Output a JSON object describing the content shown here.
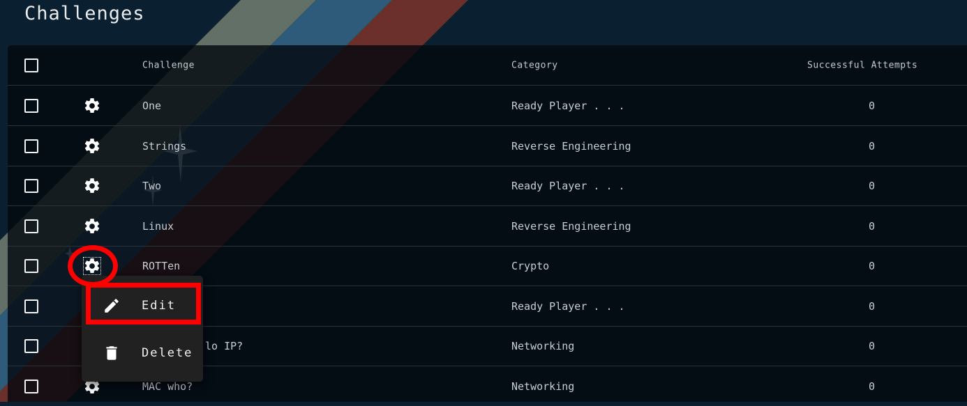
{
  "page": {
    "title": "Challenges"
  },
  "colors": {
    "page_bg": "#0a1f2f",
    "stripe_gray": "#627068",
    "stripe_blue": "#2d5b79",
    "stripe_red": "#6b302b",
    "annotation_red": "#ff0000",
    "menu_bg": "#212121"
  },
  "table": {
    "columns": {
      "select_all": "",
      "challenge": "Challenge",
      "category": "Category",
      "successful_attempts": "Successful Attempts"
    },
    "rows": [
      {
        "name": "One",
        "category": "Ready Player . . .",
        "attempts": "0"
      },
      {
        "name": "Strings",
        "category": "Reverse Engineering",
        "attempts": "0"
      },
      {
        "name": "Two",
        "category": "Ready Player . . .",
        "attempts": "0"
      },
      {
        "name": "Linux",
        "category": "Reverse Engineering",
        "attempts": "0"
      },
      {
        "name": "ROTTen",
        "category": "Crypto",
        "attempts": "0"
      },
      {
        "name": "",
        "category": "Ready Player . . .",
        "attempts": "0"
      },
      {
        "name": "lo IP?",
        "category": "Networking",
        "attempts": "0"
      },
      {
        "name": "MAC who?",
        "category": "Networking",
        "attempts": "0"
      }
    ]
  },
  "context_menu": {
    "items": [
      {
        "label": "Edit",
        "icon": "pencil-icon"
      },
      {
        "label": "Delete",
        "icon": "trash-icon"
      }
    ]
  }
}
